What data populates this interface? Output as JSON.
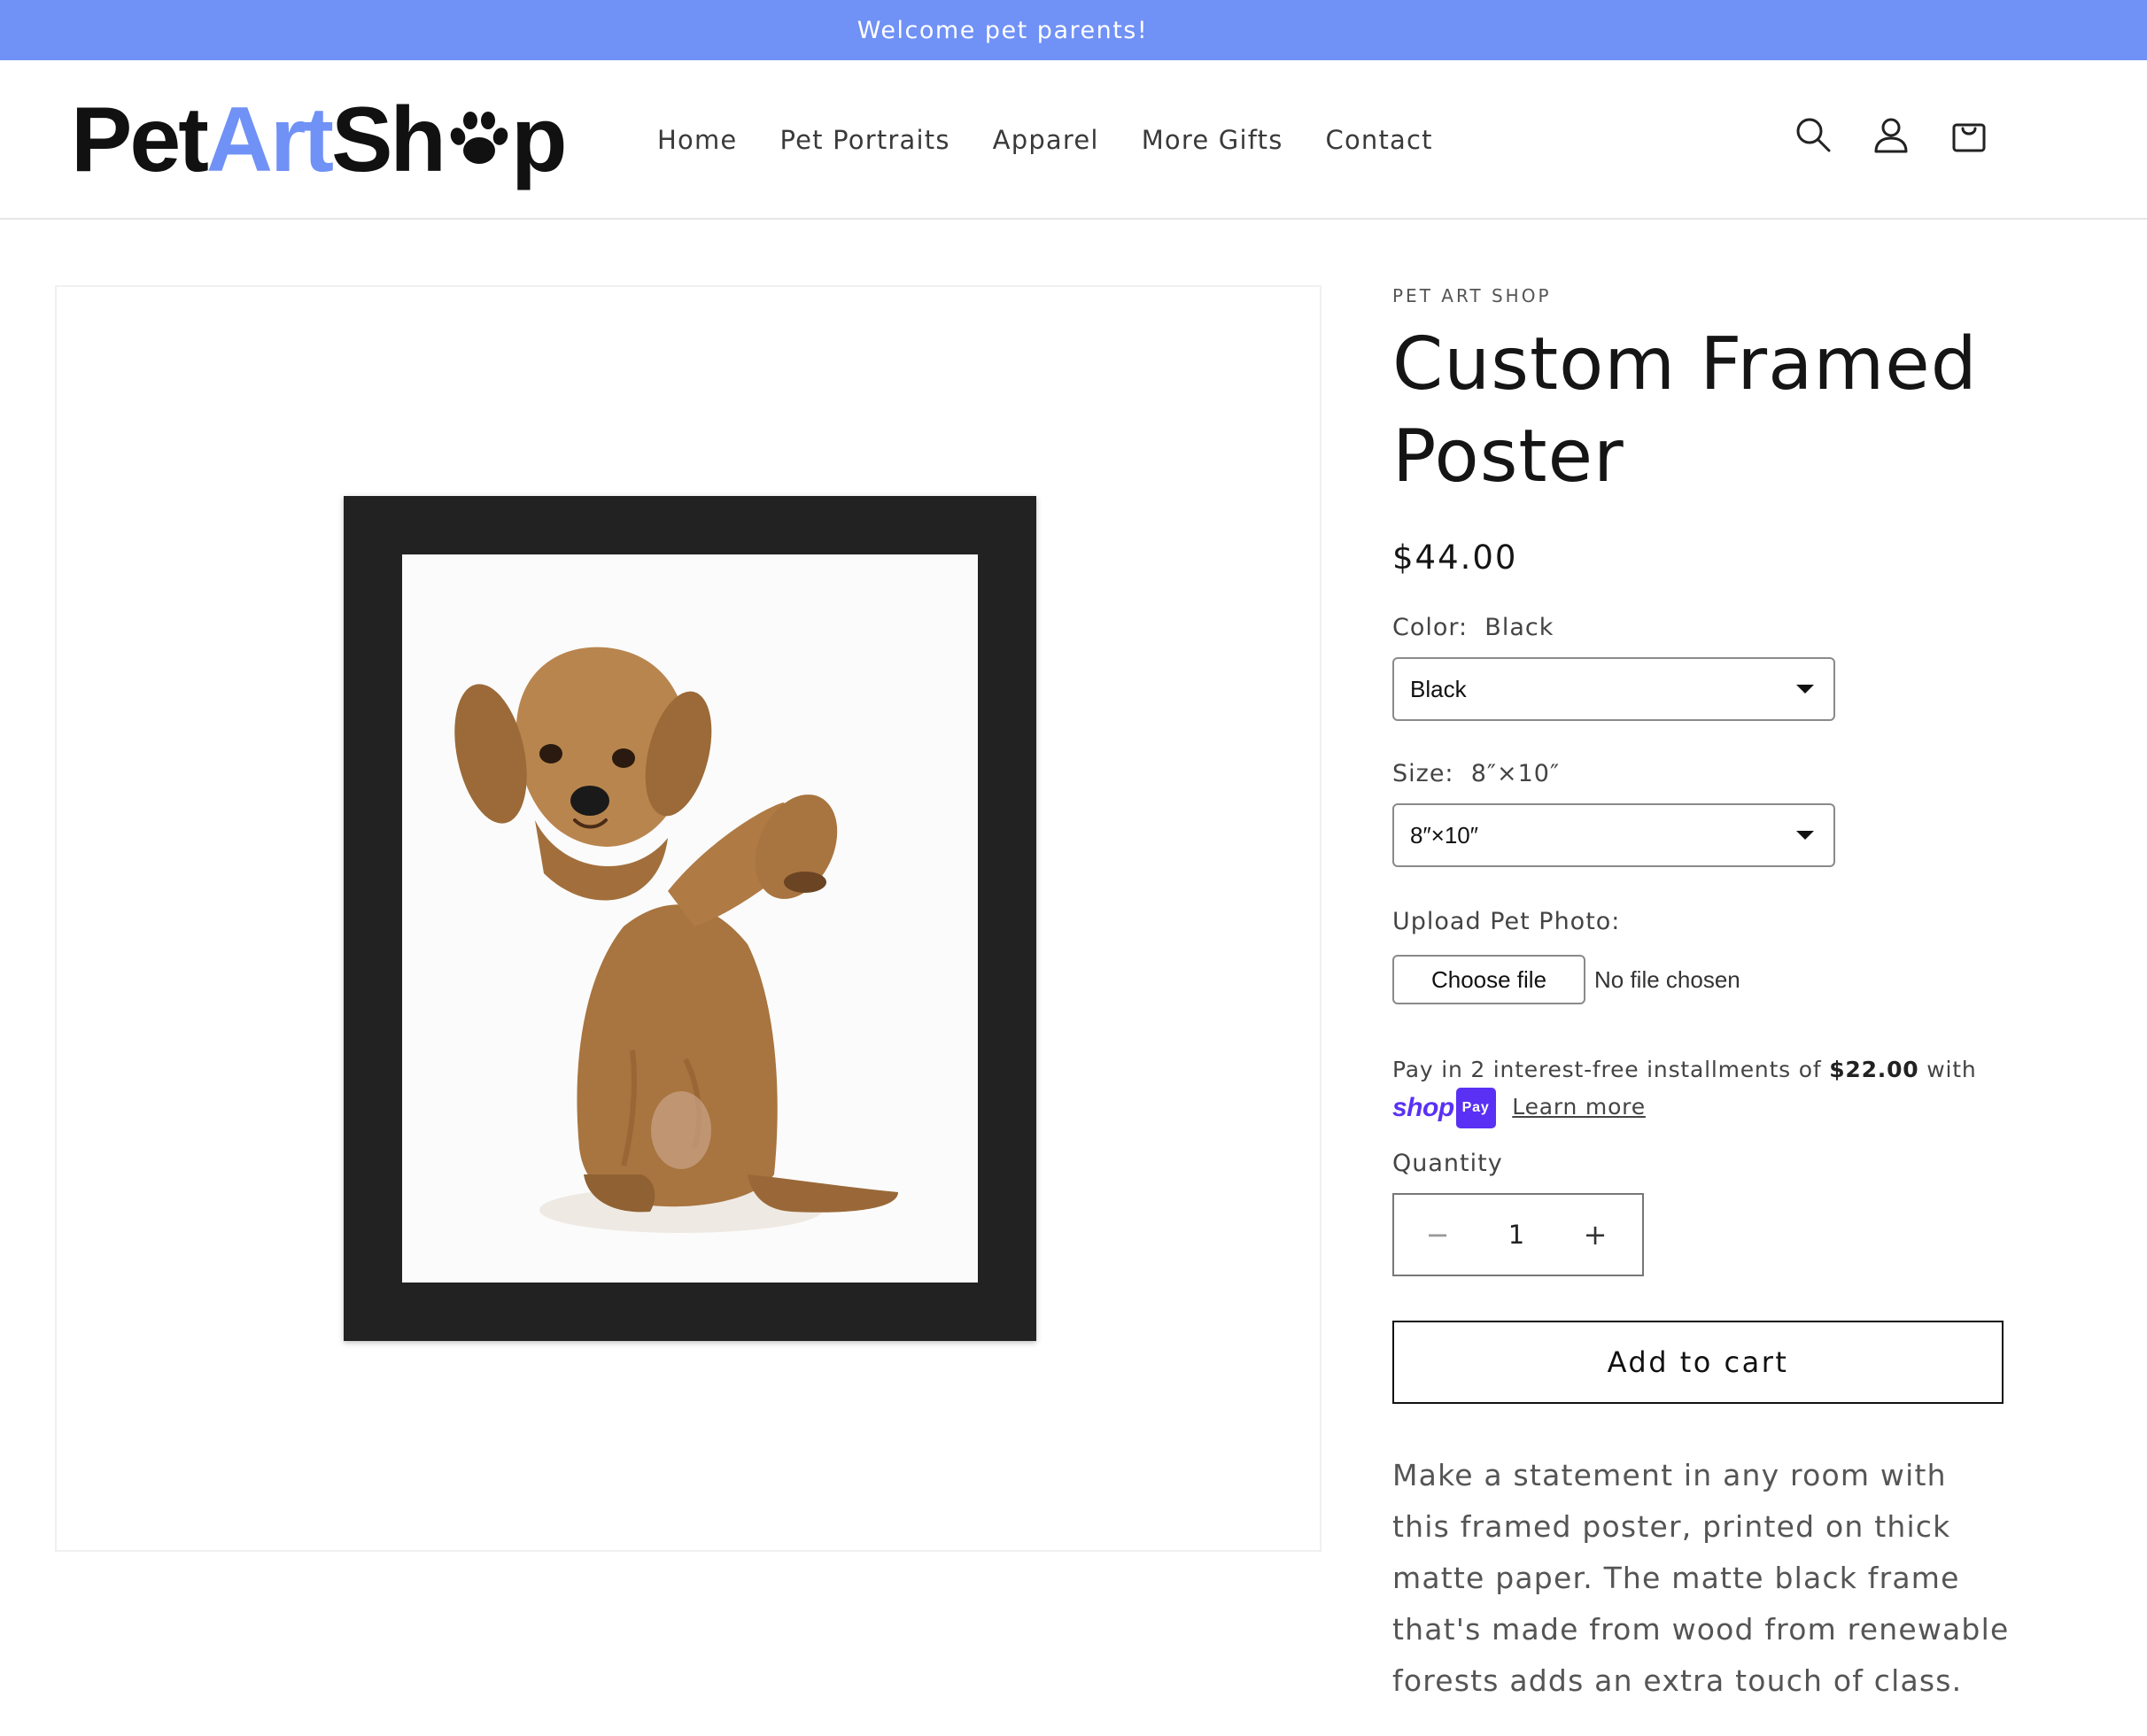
{
  "colors": {
    "accent": "#7091f5",
    "shop_pay": "#5a31f4"
  },
  "announcement": "Welcome pet parents!",
  "header": {
    "logo": {
      "part1": "Pet",
      "part2": "Art",
      "part3": "Sh",
      "part4": "p",
      "paw_icon": "paw-icon"
    },
    "nav": [
      "Home",
      "Pet Portraits",
      "Apparel",
      "More Gifts",
      "Contact"
    ],
    "icons": [
      "search-icon",
      "account-icon",
      "cart-icon"
    ]
  },
  "product": {
    "vendor": "PET ART SHOP",
    "title": "Custom Framed Poster",
    "price": "$44.00",
    "color": {
      "label": "Color:",
      "value": "Black",
      "selected": "Black"
    },
    "size": {
      "label": "Size:",
      "value": "8″×10″",
      "selected": "8″×10″"
    },
    "upload": {
      "label": "Upload Pet Photo:",
      "button": "Choose file",
      "status": "No file chosen"
    },
    "installments": {
      "prefix": "Pay in 2 interest-free installments of",
      "amount": "$22.00",
      "suffix": "with",
      "shop": "shop",
      "pay": "Pay",
      "learn_more": "Learn more"
    },
    "quantity": {
      "label": "Quantity",
      "minus": "−",
      "value": "1",
      "plus": "+"
    },
    "add_to_cart": "Add to cart",
    "description": "Make a statement in any room with this framed poster, printed on thick matte paper. The matte black frame that's made from wood from renewable forests adds an extra touch of class."
  }
}
